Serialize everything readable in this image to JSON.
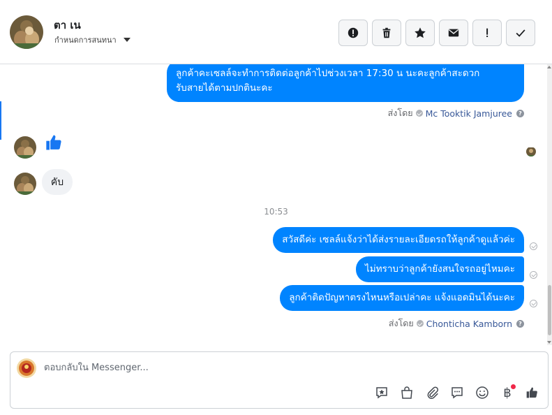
{
  "header": {
    "name": "ตา เน",
    "assign_label": "กำหนดการสนทนา"
  },
  "thread": {
    "msg1_line1": "ลูกค้าคะเซลล์จะทำการติดต่อลูกค้าไปช่วงเวลา 17:30 น นะคะลูกค้าสะดวก",
    "msg1_line2": "รับสายได้ตามปกตินะคะ",
    "sent_by_1": {
      "label": "ส่งโดย",
      "name": "Mc Tooktik Jamjuree"
    },
    "reply_in": "คับ",
    "time": "10:53",
    "msg2": "สวัสดีค่ะ เซลล์แจ้งว่าได้ส่งรายละเอียดรถให้ลูกค้าดูแล้วค่ะ",
    "msg3": "ไม่ทราบว่าลูกค้ายังสนใจรถอยู่ไหมคะ",
    "msg4": "ลูกค้าติดปัญหาตรงไหนหรือเปล่าคะ แจ้งแอดมินได้นะคะ",
    "sent_by_2": {
      "label": "ส่งโดย",
      "name": "Chonticha Kamborn"
    }
  },
  "composer": {
    "placeholder": "ตอบกลับใน Messenger...",
    "baht_symbol": "฿"
  },
  "icons": {
    "header_actions": [
      "alert-circle-icon",
      "trash-icon",
      "star-icon",
      "envelope-icon",
      "exclamation-icon",
      "check-icon"
    ],
    "composer_tools": [
      "saved-reply-icon",
      "shop-bag-icon",
      "attachment-icon",
      "quick-reply-icon",
      "emoji-icon",
      "baht-payment-icon",
      "like-icon"
    ]
  },
  "colors": {
    "bubble_out": "#0084ff",
    "bubble_in": "#f0f2f5",
    "accent": "#1877f2",
    "notify_dot": "#f02849"
  }
}
